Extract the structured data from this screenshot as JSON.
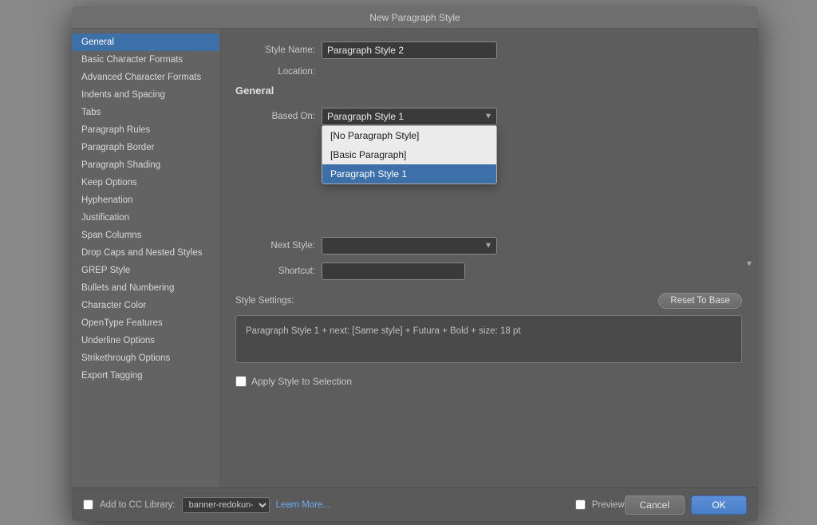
{
  "window": {
    "title": "New Paragraph Style"
  },
  "sidebar": {
    "items": [
      {
        "label": "General",
        "active": true
      },
      {
        "label": "Basic Character Formats",
        "active": false
      },
      {
        "label": "Advanced Character Formats",
        "active": false
      },
      {
        "label": "Indents and Spacing",
        "active": false
      },
      {
        "label": "Tabs",
        "active": false
      },
      {
        "label": "Paragraph Rules",
        "active": false
      },
      {
        "label": "Paragraph Border",
        "active": false
      },
      {
        "label": "Paragraph Shading",
        "active": false
      },
      {
        "label": "Keep Options",
        "active": false
      },
      {
        "label": "Hyphenation",
        "active": false
      },
      {
        "label": "Justification",
        "active": false
      },
      {
        "label": "Span Columns",
        "active": false
      },
      {
        "label": "Drop Caps and Nested Styles",
        "active": false
      },
      {
        "label": "GREP Style",
        "active": false
      },
      {
        "label": "Bullets and Numbering",
        "active": false
      },
      {
        "label": "Character Color",
        "active": false
      },
      {
        "label": "OpenType Features",
        "active": false
      },
      {
        "label": "Underline Options",
        "active": false
      },
      {
        "label": "Strikethrough Options",
        "active": false
      },
      {
        "label": "Export Tagging",
        "active": false
      }
    ]
  },
  "main": {
    "section_title": "General",
    "style_name_label": "Style Name:",
    "style_name_value": "Paragraph Style 2",
    "location_label": "Location:",
    "location_value": "",
    "based_on_label": "Based On:",
    "based_on_value": "Paragraph Style 1",
    "next_style_label": "Next Style:",
    "next_style_value": "",
    "shortcut_label": "Shortcut:",
    "shortcut_value": "",
    "dropdown_options": [
      {
        "label": "[No Paragraph Style]",
        "selected": false
      },
      {
        "label": "[Basic Paragraph]",
        "selected": false
      },
      {
        "label": "Paragraph Style 1",
        "selected": true
      }
    ],
    "style_settings_label": "Style Settings:",
    "reset_button_label": "Reset To Base",
    "style_settings_value": "Paragraph Style 1 + next: [Same style] + Futura + Bold + size: 18 pt",
    "apply_checkbox_label": "Apply Style to Selection"
  },
  "bottom": {
    "add_to_library_label": "Add to CC Library:",
    "library_dropdown_value": "banner-redokun-...",
    "learn_more_label": "Learn More...",
    "preview_label": "Preview",
    "cancel_label": "Cancel",
    "ok_label": "OK"
  }
}
